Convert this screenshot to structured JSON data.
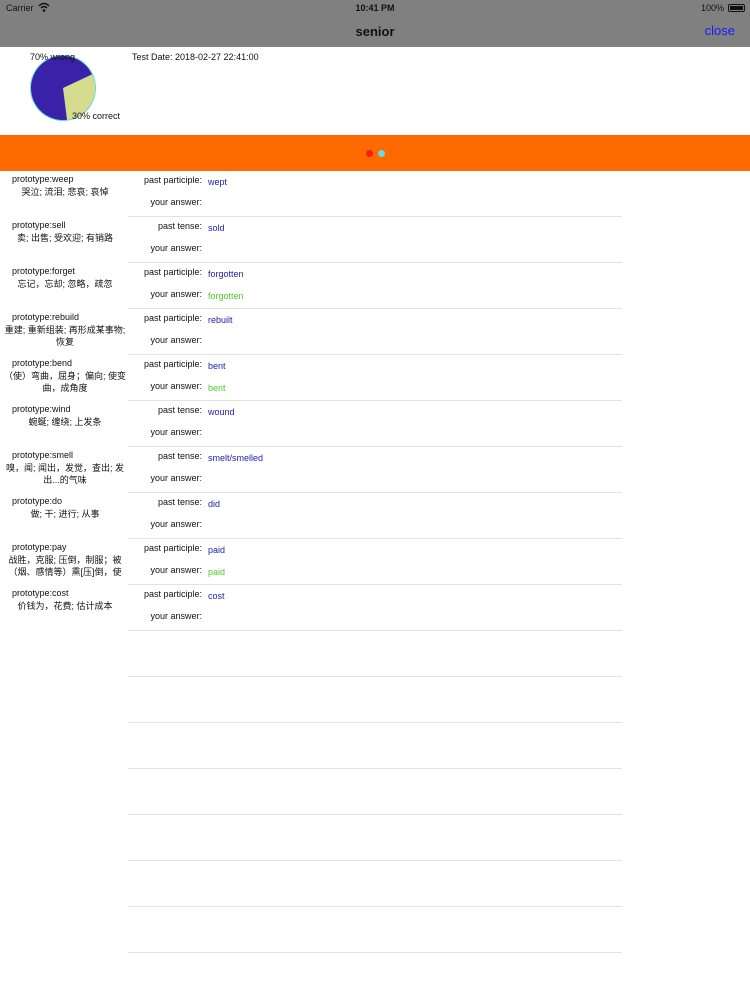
{
  "status_bar": {
    "carrier": "Carrier",
    "time": "10:41 PM",
    "battery": "100%"
  },
  "nav": {
    "title": "senior",
    "close_label": "close"
  },
  "summary": {
    "wrong_label": "70% wrong",
    "correct_label": "30% correct",
    "test_date": "Test Date: 2018-02-27 22:41:00",
    "wrong_fraction": 0.7,
    "colors": {
      "wrong": "#3a22a8",
      "correct": "#d6dc8e",
      "outline": "#66dddd"
    }
  },
  "page_indicator": {
    "colors": [
      "#ff1a1a",
      "#66dddd"
    ],
    "bar_color": "#ff6a00"
  },
  "items": [
    {
      "prototype": "prototype:weep",
      "meaning": "哭泣; 流泪; 悲哀; 哀悼",
      "form_label": "past participle:",
      "form_value": "wept",
      "answer_label": "your answer:",
      "answer_value": ""
    },
    {
      "prototype": "prototype:sell",
      "meaning": "卖; 出售; 受欢迎; 有销路",
      "form_label": "past tense:",
      "form_value": "sold",
      "answer_label": "your answer:",
      "answer_value": ""
    },
    {
      "prototype": "prototype:forget",
      "meaning": "忘记，忘却; 忽略，疏忽",
      "form_label": "past participle:",
      "form_value": "forgotten",
      "answer_label": "your answer:",
      "answer_value": "forgotten"
    },
    {
      "prototype": "prototype:rebuild",
      "meaning": "重建; 重新组装; 再形成某事物; 恢复",
      "form_label": "past participle:",
      "form_value": "rebuilt",
      "answer_label": "your answer:",
      "answer_value": ""
    },
    {
      "prototype": "prototype:bend",
      "meaning": "（使）弯曲，屈身；偏向; 使变曲，成角度",
      "form_label": "past participle:",
      "form_value": "bent",
      "answer_label": "your answer:",
      "answer_value": "bent"
    },
    {
      "prototype": "prototype:wind",
      "meaning": "蜿蜒; 缠绕; 上发条",
      "form_label": "past tense:",
      "form_value": "wound",
      "answer_label": "your answer:",
      "answer_value": ""
    },
    {
      "prototype": "prototype:smell",
      "meaning": "嗅，闻; 闻出，发觉，查出; 发出...的气味",
      "form_label": "past tense:",
      "form_value": "smelt/smelled",
      "answer_label": "your answer:",
      "answer_value": ""
    },
    {
      "prototype": "prototype:do",
      "meaning": "做; 干; 进行; 从事",
      "form_label": "past tense:",
      "form_value": "did",
      "answer_label": "your answer:",
      "answer_value": ""
    },
    {
      "prototype": "prototype:pay",
      "meaning": "战胜，克服; 压倒，制服；被（烟、感情等）熏[压]倒，使",
      "form_label": "past participle:",
      "form_value": "paid",
      "answer_label": "your answer:",
      "answer_value": "paid"
    },
    {
      "prototype": "prototype:cost",
      "meaning": "价钱为，花费; 估计成本",
      "form_label": "past participle:",
      "form_value": "cost",
      "answer_label": "your answer:",
      "answer_value": ""
    }
  ],
  "empty_rows": 7
}
